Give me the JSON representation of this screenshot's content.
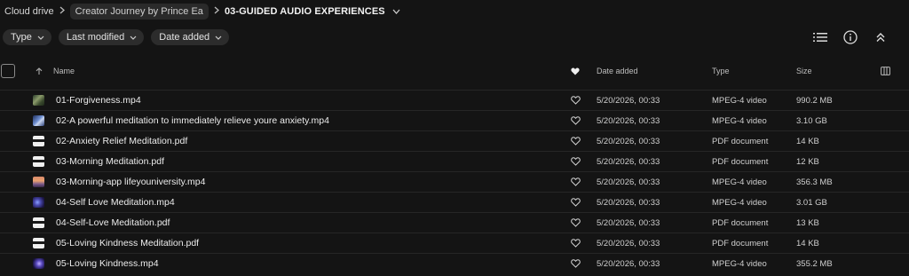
{
  "breadcrumb": {
    "root": "Cloud drive",
    "middle": "Creator Journey by Prince Ea",
    "current": "03-GUIDED AUDIO EXPERIENCES"
  },
  "filters": [
    {
      "label": "Type"
    },
    {
      "label": "Last modified"
    },
    {
      "label": "Date added"
    }
  ],
  "toolbar_icons": [
    "list-view-icon",
    "info-icon",
    "collapse-icon"
  ],
  "table": {
    "columns": {
      "name": "Name",
      "date_added": "Date added",
      "type": "Type",
      "size": "Size"
    },
    "rows": [
      {
        "name": "01-Forgiveness.mp4",
        "date": "5/20/2026, 00:33",
        "type": "MPEG-4 video",
        "size": "990.2 MB",
        "thumb": "video-forgiveness"
      },
      {
        "name": "02-A powerful meditation to immediately relieve youre anxiety.mp4",
        "date": "5/20/2026, 00:33",
        "type": "MPEG-4 video",
        "size": "3.10 GB",
        "thumb": "video-anxiety"
      },
      {
        "name": "02-Anxiety Relief Meditation.pdf",
        "date": "5/20/2026, 00:33",
        "type": "PDF document",
        "size": "14 KB",
        "thumb": "pdf"
      },
      {
        "name": "03-Morning Meditation.pdf",
        "date": "5/20/2026, 00:33",
        "type": "PDF document",
        "size": "12 KB",
        "thumb": "pdf"
      },
      {
        "name": "03-Morning-app lifeyouniversity.mp4",
        "date": "5/20/2026, 00:33",
        "type": "MPEG-4 video",
        "size": "356.3 MB",
        "thumb": "video-morning"
      },
      {
        "name": "04-Self Love Meditation.mp4",
        "date": "5/20/2026, 00:33",
        "type": "MPEG-4 video",
        "size": "3.01 GB",
        "thumb": "video-self-love"
      },
      {
        "name": "04-Self-Love Meditation.pdf",
        "date": "5/20/2026, 00:33",
        "type": "PDF document",
        "size": "13 KB",
        "thumb": "pdf"
      },
      {
        "name": "05-Loving Kindness Meditation.pdf",
        "date": "5/20/2026, 00:33",
        "type": "PDF document",
        "size": "14 KB",
        "thumb": "pdf"
      },
      {
        "name": "05-Loving Kindness.mp4",
        "date": "5/20/2026, 00:33",
        "type": "MPEG-4 video",
        "size": "355.2 MB",
        "thumb": "video-loving-kindness"
      }
    ]
  }
}
